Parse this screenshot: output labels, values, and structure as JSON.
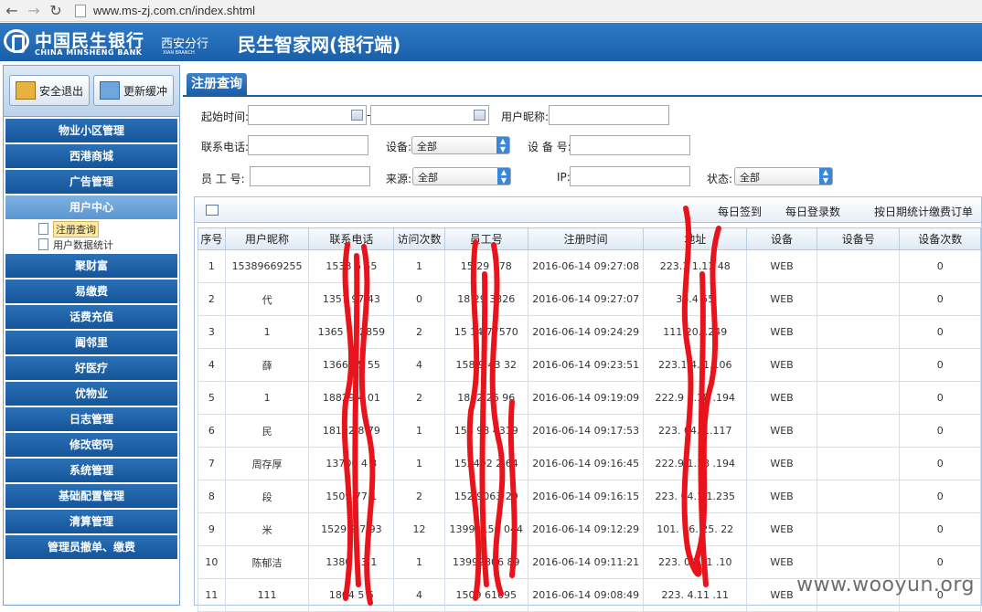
{
  "browser": {
    "url": "www.ms-zj.com.cn/index.shtml",
    "back_icon": "←",
    "forward_icon": "→",
    "reload_icon": "↻"
  },
  "header": {
    "logo_cn": "中国民生银行",
    "logo_en": "CHINA MINSHENG BANK",
    "branch": "西安分行",
    "branch_en": "XIAN BRANCH",
    "title": "民生智家网(银行端)"
  },
  "sidebar": {
    "exit_label": "安全退出",
    "refresh_label": "更新缓冲",
    "menu_before": [
      "物业小区管理",
      "西港商城",
      "广告管理"
    ],
    "active": "用户中心",
    "sub_items": [
      "注册查询",
      "用户数据统计"
    ],
    "menu_after": [
      "聚财富",
      "易缴费",
      "话费充值",
      "阖邻里",
      "好医疗",
      "优物业",
      "日志管理",
      "修改密码",
      "系统管理",
      "基础配置管理",
      "清算管理",
      "管理员撤单、缴费"
    ]
  },
  "tab": {
    "label": "注册查询"
  },
  "filters": {
    "start_time_label": "起始时间:",
    "dash": "-",
    "nickname_label": "用户昵称:",
    "phone_label": "联系电话:",
    "device_label": "设备:",
    "device_value": "全部",
    "device_no_label": "设 备 号:",
    "staff_no_label": "员 工 号:",
    "source_label": "来源:",
    "source_value": "全部",
    "ip_label": "IP:",
    "status_label": "状态:",
    "status_value": "全部"
  },
  "toolbar": {
    "daily_signin": "每日签到",
    "daily_login": "每日登录数",
    "by_date_fee": "按日期统计缴费订单"
  },
  "table": {
    "headers": [
      "序号",
      "用户昵称",
      "联系电话",
      "访问次数",
      "员工号",
      "注册时间",
      "地址",
      "设备",
      "设备号",
      "设备次数"
    ],
    "rows": [
      [
        "1",
        "15389669255",
        "1538  6  55",
        "1",
        "15  29  178",
        "2016-06-14 09:27:08",
        "223.1  1.11  48",
        "WEB",
        "",
        "0"
      ],
      [
        "2",
        "代",
        "1357  97  43",
        "0",
        "18  29  3326",
        "2016-06-14 09:27:07",
        "36.4    55",
        "WEB",
        "",
        "0"
      ],
      [
        "3",
        "1",
        "1365  232859",
        "2",
        "15  14  77570",
        "2016-06-14 09:24:29",
        "111.20.   .249",
        "WEB",
        "",
        "0"
      ],
      [
        "4",
        "薛",
        "1366  25  55",
        "4",
        "158  9  43  32",
        "2016-06-14 09:23:51",
        "223.1  4.  1.106",
        "WEB",
        "",
        "0"
      ],
      [
        "5",
        "1",
        "18829  4  01",
        "2",
        "1862  26  96",
        "2016-06-14 09:19:09",
        "222.9  1.18  .194",
        "WEB",
        "",
        "0"
      ],
      [
        "6",
        "民",
        "18192  8  79",
        "1",
        "158  98  4319",
        "2016-06-14 09:17:53",
        "223.  04.  1.117",
        "WEB",
        "",
        "0"
      ],
      [
        "7",
        "周存厚",
        "13700  4  3",
        "1",
        "152492  2  64",
        "2016-06-14 09:16:45",
        "222.9  1.18  .194",
        "WEB",
        "",
        "0"
      ],
      [
        "8",
        "段",
        "1509  77  1",
        "2",
        "152  9063  29",
        "2016-06-14 09:16:15",
        "223.  04.1  1.235",
        "WEB",
        "",
        "0"
      ],
      [
        "9",
        "米",
        "1529  9  7  93",
        "12",
        "13991150  044",
        "2016-06-14 09:12:29",
        "101.  26.  25.  22",
        "WEB",
        "",
        "0"
      ],
      [
        "10",
        "陈郁洁",
        "1380  13  1",
        "1",
        "13992806  89",
        "2016-06-14 09:11:21",
        "223.  04.11  .10",
        "WEB",
        "",
        "0"
      ],
      [
        "11",
        "111",
        "1804  5  5",
        "4",
        "1509  61695",
        "2016-06-14 09:08:49",
        "223.  4.11  .11",
        "WEB",
        "",
        "0"
      ]
    ]
  },
  "watermark": "www.wooyun.org",
  "colors": {
    "header_blue": "#1a5ea8",
    "menu_blue": "#15559a",
    "active_menu": "#5b96d1",
    "redaction": "#e8131b"
  }
}
